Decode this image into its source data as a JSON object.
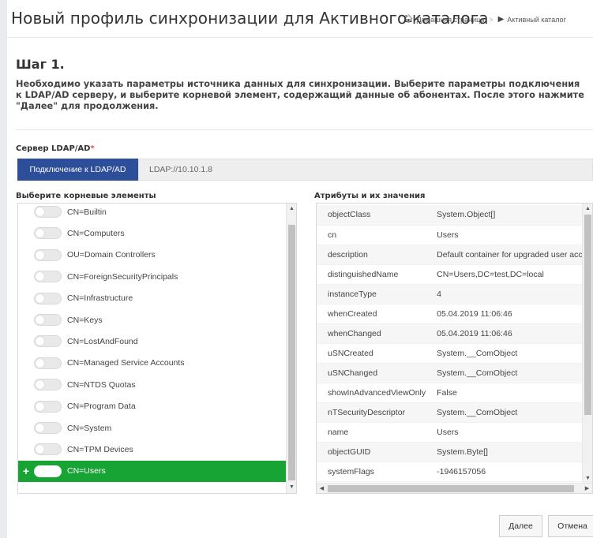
{
  "header": {
    "title": "Новый профиль синхронизации для Активного каталога",
    "breadcrumb": [
      {
        "icon": "home-icon",
        "label": "Домашняя страница"
      },
      {
        "icon": "folder-icon",
        "label": "Активный каталог"
      }
    ],
    "breadcrumb_separator": ">"
  },
  "step": {
    "title": "Шаг 1.",
    "description": "Необходимо указать параметры источника данных для синхронизации. Выберите параметры подключения к LDAP/AD серверу, и выберите корневой элемент, содержащий данные об абонентах. После этого нажмите \"Далее\" для продолжения."
  },
  "server": {
    "label": "Сервер LDAP/AD",
    "required_mark": "*",
    "connect_button": "Подключение к LDAP/AD",
    "address": "LDAP://10.10.1.8"
  },
  "tree": {
    "label": "Выберите корневые элементы",
    "items": [
      {
        "label": "CN=Builtin",
        "selected": false
      },
      {
        "label": "CN=Computers",
        "selected": false
      },
      {
        "label": "OU=Domain Controllers",
        "selected": false
      },
      {
        "label": "CN=ForeignSecurityPrincipals",
        "selected": false
      },
      {
        "label": "CN=Infrastructure",
        "selected": false
      },
      {
        "label": "CN=Keys",
        "selected": false
      },
      {
        "label": "CN=LostAndFound",
        "selected": false
      },
      {
        "label": "CN=Managed Service Accounts",
        "selected": false
      },
      {
        "label": "CN=NTDS Quotas",
        "selected": false
      },
      {
        "label": "CN=Program Data",
        "selected": false
      },
      {
        "label": "CN=System",
        "selected": false
      },
      {
        "label": "CN=TPM Devices",
        "selected": false
      },
      {
        "label": "CN=Users",
        "selected": true
      }
    ],
    "expand_symbol": "+"
  },
  "attributes": {
    "label": "Атрибуты и их значения",
    "rows": [
      {
        "name": "objectClass",
        "value": "System.Object[]"
      },
      {
        "name": "cn",
        "value": "Users"
      },
      {
        "name": "description",
        "value": "Default container for upgraded user accounts"
      },
      {
        "name": "distinguishedName",
        "value": "CN=Users,DC=test,DC=local"
      },
      {
        "name": "instanceType",
        "value": "4"
      },
      {
        "name": "whenCreated",
        "value": "05.04.2019 11:06:46"
      },
      {
        "name": "whenChanged",
        "value": "05.04.2019 11:06:46"
      },
      {
        "name": "uSNCreated",
        "value": "System.__ComObject"
      },
      {
        "name": "uSNChanged",
        "value": "System.__ComObject"
      },
      {
        "name": "showInAdvancedViewOnly",
        "value": "False"
      },
      {
        "name": "nTSecurityDescriptor",
        "value": "System.__ComObject"
      },
      {
        "name": "name",
        "value": "Users"
      },
      {
        "name": "objectGUID",
        "value": "System.Byte[]"
      },
      {
        "name": "systemFlags",
        "value": "-1946157056"
      }
    ]
  },
  "footer": {
    "next_button": "Далее",
    "cancel_button": "Отмена"
  },
  "colors": {
    "primary_button": "#2d4e99",
    "selected_row": "#18a335",
    "required": "#d9534f"
  }
}
